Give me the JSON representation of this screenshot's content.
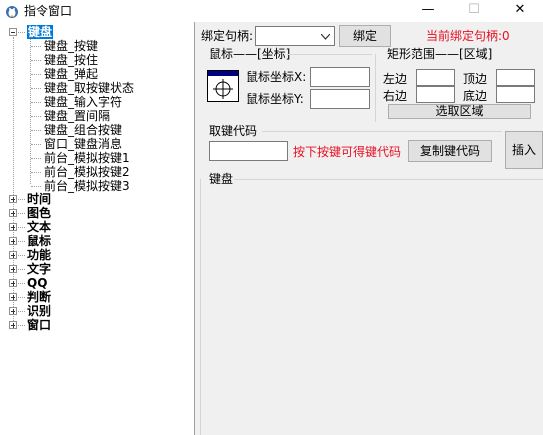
{
  "window": {
    "title": "指令窗口",
    "min_glyph": "—",
    "max_glyph": "☐",
    "close_glyph": "✕"
  },
  "tree": {
    "root_label": "键盘",
    "children": [
      "键盘_按键",
      "键盘_按住",
      "键盘_弹起",
      "键盘_取按键状态",
      "键盘_输入字符",
      "键盘_置间隔",
      "键盘_组合按键",
      "窗口_键盘消息",
      "前台_模拟按键1",
      "前台_模拟按键2",
      "前台_模拟按键3"
    ],
    "categories": [
      "时间",
      "图色",
      "文本",
      "鼠标",
      "功能",
      "文字",
      "QQ",
      "判断",
      "识别",
      "窗口"
    ]
  },
  "bind": {
    "label": "绑定句柄:",
    "value": "",
    "button": "绑定",
    "status": "当前绑定句柄:0"
  },
  "mouse_group": {
    "title": "鼠标——[坐标]",
    "x_label": "鼠标坐标X:",
    "y_label": "鼠标坐标Y:",
    "x_value": "",
    "y_value": ""
  },
  "rect_group": {
    "title": "矩形范围——[区域]",
    "left_label": "左边",
    "top_label": "顶边",
    "right_label": "右边",
    "bottom_label": "底边",
    "select_button": "选取区域"
  },
  "key_group": {
    "title": "取键代码",
    "value": "",
    "hint": "按下按键可得键代码",
    "copy_button": "复制键代码"
  },
  "insert_button": "插入",
  "keyboard_group": {
    "title": "键盘"
  },
  "colors": {
    "accent": "#0078d7",
    "status_red": "#e81123"
  }
}
